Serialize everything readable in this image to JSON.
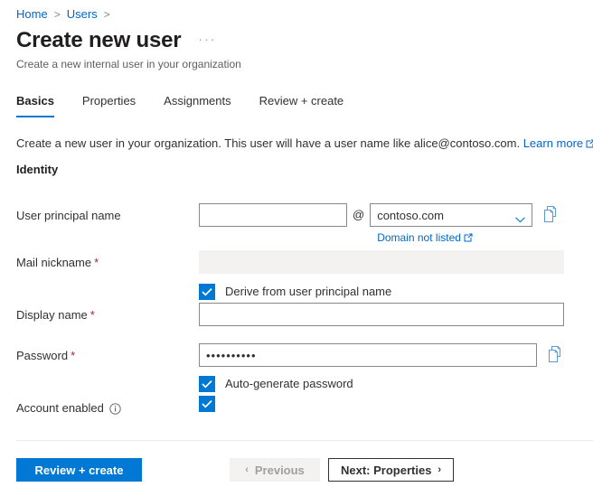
{
  "breadcrumb": {
    "items": [
      {
        "label": "Home"
      },
      {
        "label": "Users"
      }
    ],
    "separator": ">"
  },
  "header": {
    "title": "Create new user",
    "subtitle": "Create a new internal user in your organization",
    "more_commands": "···"
  },
  "tabs": [
    {
      "label": "Basics",
      "active": true
    },
    {
      "label": "Properties",
      "active": false
    },
    {
      "label": "Assignments",
      "active": false
    },
    {
      "label": "Review + create",
      "active": false
    }
  ],
  "intro": {
    "text": "Create a new user in your organization. This user will have a user name like alice@contoso.com.",
    "link_label": "Learn more"
  },
  "section": {
    "identity_heading": "Identity"
  },
  "form": {
    "upn": {
      "label": "User principal name",
      "value": "",
      "placeholder": "",
      "at": "@",
      "domain_value": "contoso.com",
      "domain_note": "Domain not listed",
      "copy_title": "Copy to clipboard"
    },
    "mail_nickname": {
      "label": "Mail nickname",
      "required": "*",
      "value": "",
      "checkbox_label": "Derive from user principal name",
      "checkbox_checked": true
    },
    "display_name": {
      "label": "Display name",
      "required": "*",
      "value": "",
      "placeholder": ""
    },
    "password": {
      "label": "Password",
      "required": "*",
      "value": "••••••••••",
      "checkbox_label": "Auto-generate password",
      "checkbox_checked": true,
      "copy_title": "Copy to clipboard"
    },
    "account_enabled": {
      "label": "Account enabled",
      "checked": true,
      "info_title": "Account enabled information"
    }
  },
  "footer": {
    "review_create": "Review + create",
    "previous": "Previous",
    "previous_arrow": "‹",
    "next": "Next: Properties",
    "next_arrow": "›"
  },
  "colors": {
    "accent": "#0078d4",
    "link": "#0066cc",
    "required": "#a4262c",
    "disabled_bg": "#f3f2f1",
    "border": "#8a8886"
  }
}
